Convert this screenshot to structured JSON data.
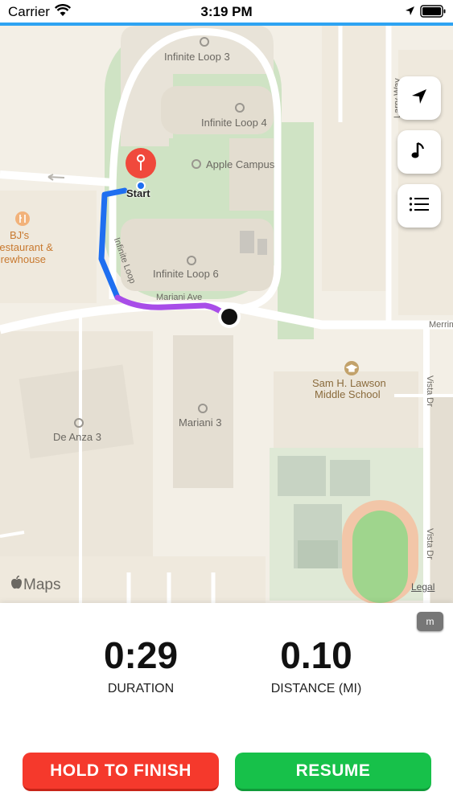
{
  "status_bar": {
    "carrier": "Carrier",
    "time": "3:19 PM",
    "icons": [
      "wifi-icon",
      "location-arrow-icon",
      "battery-icon"
    ]
  },
  "map": {
    "labels": {
      "infinite_loop_3": "Infinite Loop 3",
      "infinite_loop_4": "Infinite Loop 4",
      "apple_campus": "Apple Campus",
      "infinite_loop_6": "Infinite Loop 6",
      "infinite_loop_road": "Infinite Loop",
      "mariani_ave": "Mariani Ave",
      "larry_way": "Larry Way",
      "merriman": "Merriman",
      "vista_dr_1": "Vista Dr",
      "vista_dr_2": "Vista Dr",
      "bjs_line1": "BJ's",
      "bjs_line2": "Restaurant &",
      "bjs_line3": "Brewhouse",
      "sam_lawson_line1": "Sam H. Lawson",
      "sam_lawson_line2": "Middle School",
      "mariani_3": "Mariani 3",
      "de_anza_3": "De Anza 3",
      "start": "Start"
    },
    "attribution": "Maps",
    "legal": "Legal",
    "route_colors": {
      "segment_1": "#1f6ff0",
      "segment_2": "#a84de8"
    },
    "controls": [
      "location-arrow-icon",
      "music-note-icon",
      "list-icon"
    ]
  },
  "panel": {
    "unit_toggle": "m",
    "duration": {
      "value": "0:29",
      "label": "DURATION"
    },
    "distance": {
      "value": "0.10",
      "label": "DISTANCE (MI)"
    },
    "buttons": {
      "finish": "HOLD TO FINISH",
      "resume": "RESUME"
    }
  },
  "colors": {
    "accent": "#2ea3f2",
    "finish": "#f5392c",
    "resume": "#17c14a",
    "start_pin": "#f0493c"
  }
}
